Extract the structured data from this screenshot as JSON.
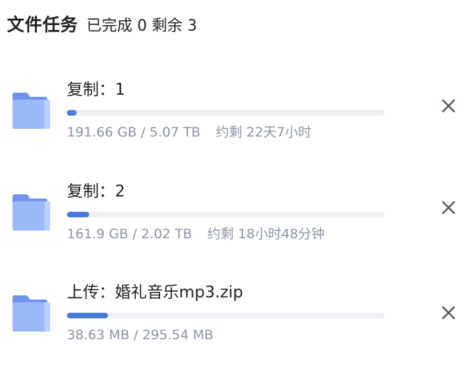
{
  "header": {
    "title": "文件任务",
    "summary": "已完成 0 剩余 3"
  },
  "colors": {
    "accent": "#4a78d6",
    "track": "#eef0f3",
    "folder": "#8fb0f5",
    "meta_text": "#8a94a6",
    "close_icon": "#4a5568"
  },
  "tasks": [
    {
      "name": "复制：1",
      "progress": 0.03,
      "size": "191.66 GB / 5.07 TB",
      "remaining": "约剩 22天7小时",
      "icon": "folder-icon",
      "close_icon": "close-icon"
    },
    {
      "name": "复制：2",
      "progress": 0.07,
      "size": "161.9 GB / 2.02 TB",
      "remaining": "约剩 18小时48分钟",
      "icon": "folder-icon",
      "close_icon": "close-icon"
    },
    {
      "name": "上传：婚礼音乐mp3.zip",
      "progress": 0.13,
      "size": "38.63 MB / 295.54 MB",
      "remaining": "",
      "icon": "folder-icon",
      "close_icon": "close-icon"
    }
  ]
}
